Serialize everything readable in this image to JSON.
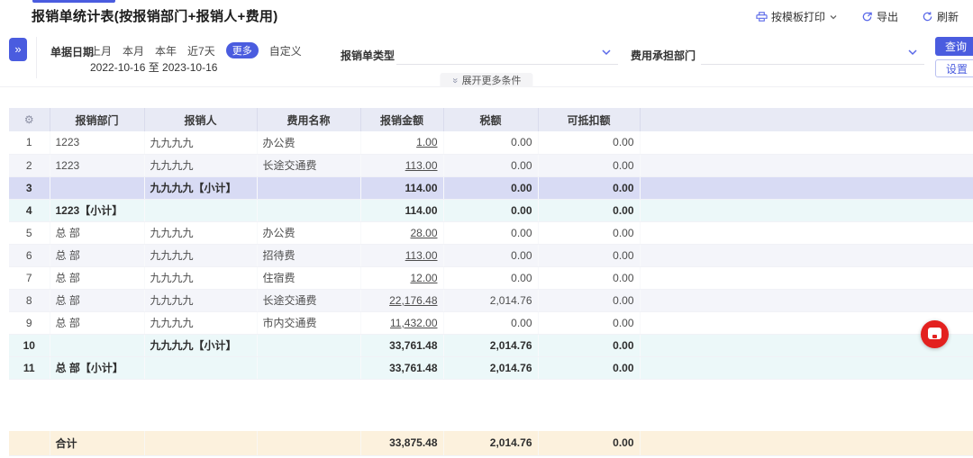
{
  "page": {
    "title": "报销单统计表(按报销部门+报销人+费用)"
  },
  "toolbar": {
    "print_label": "按模板打印",
    "export_label": "导出",
    "refresh_label": "刷新"
  },
  "filters": {
    "date_label": "单据日期",
    "quick_options": [
      "上月",
      "本月",
      "本年",
      "近7天"
    ],
    "more_label": "更多",
    "custom_label": "自定义",
    "date_range": "2022-10-16 至 2023-10-16",
    "type_label": "报销单类型",
    "dept_label": "费用承担部门",
    "query_label": "查询",
    "settings_label": "设置",
    "expand_more_label": "展开更多条件"
  },
  "table": {
    "columns": [
      "报销部门",
      "报销人",
      "费用名称",
      "报销金额",
      "税额",
      "可抵扣额"
    ],
    "rows": [
      {
        "no": "1",
        "dept": "1223",
        "person": "九九九九",
        "expense": "办公费",
        "amount": "1.00",
        "tax": "0.00",
        "deductible": "0.00",
        "link": true,
        "style": "plain"
      },
      {
        "no": "2",
        "dept": "1223",
        "person": "九九九九",
        "expense": "长途交通费",
        "amount": "113.00",
        "tax": "0.00",
        "deductible": "0.00",
        "link": true,
        "style": "zebra"
      },
      {
        "no": "3",
        "dept": "",
        "person": "九九九九【小计】",
        "expense": "",
        "amount": "114.00",
        "tax": "0.00",
        "deductible": "0.00",
        "link": false,
        "style": "selected"
      },
      {
        "no": "4",
        "dept": "1223【小计】",
        "person": "",
        "expense": "",
        "amount": "114.00",
        "tax": "0.00",
        "deductible": "0.00",
        "link": false,
        "style": "subtotal"
      },
      {
        "no": "5",
        "dept": "总 部",
        "person": "九九九九",
        "expense": "办公费",
        "amount": "28.00",
        "tax": "0.00",
        "deductible": "0.00",
        "link": true,
        "style": "plain"
      },
      {
        "no": "6",
        "dept": "总 部",
        "person": "九九九九",
        "expense": "招待费",
        "amount": "113.00",
        "tax": "0.00",
        "deductible": "0.00",
        "link": true,
        "style": "zebra"
      },
      {
        "no": "7",
        "dept": "总 部",
        "person": "九九九九",
        "expense": "住宿费",
        "amount": "12.00",
        "tax": "0.00",
        "deductible": "0.00",
        "link": true,
        "style": "plain"
      },
      {
        "no": "8",
        "dept": "总 部",
        "person": "九九九九",
        "expense": "长途交通费",
        "amount": "22,176.48",
        "tax": "2,014.76",
        "deductible": "0.00",
        "link": true,
        "style": "zebra"
      },
      {
        "no": "9",
        "dept": "总 部",
        "person": "九九九九",
        "expense": "市内交通费",
        "amount": "11,432.00",
        "tax": "0.00",
        "deductible": "0.00",
        "link": true,
        "style": "plain"
      },
      {
        "no": "10",
        "dept": "",
        "person": "九九九九【小计】",
        "expense": "",
        "amount": "33,761.48",
        "tax": "2,014.76",
        "deductible": "0.00",
        "link": false,
        "style": "subtotal"
      },
      {
        "no": "11",
        "dept": "总 部【小计】",
        "person": "",
        "expense": "",
        "amount": "33,761.48",
        "tax": "2,014.76",
        "deductible": "0.00",
        "link": false,
        "style": "subtotal"
      }
    ],
    "total": {
      "label": "合计",
      "amount": "33,875.48",
      "tax": "2,014.76",
      "deductible": "0.00"
    }
  },
  "colors": {
    "primary_blue": "#4a5cdf",
    "header_bg": "#e8eaf5",
    "selected_row_bg": "#d8dbf4",
    "subtotal_row_bg": "#ecf8f9",
    "total_row_bg": "#fcf1dd",
    "float_button_red": "#e3211f"
  }
}
